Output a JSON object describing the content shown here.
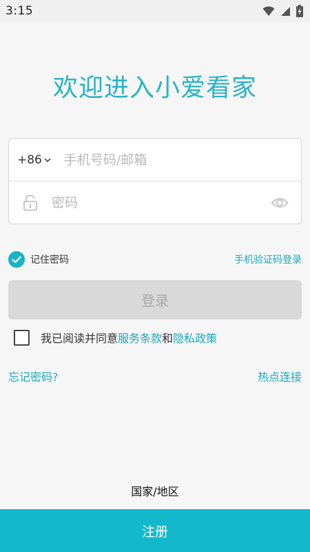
{
  "status_bar": {
    "time": "3:15",
    "icons": [
      "wifi-icon",
      "cellular-signal-icon",
      "battery-charging-icon"
    ]
  },
  "welcome": {
    "title": "欢迎进入小爱看家"
  },
  "login_form": {
    "country_code": "+86",
    "phone_placeholder": "手机号码/邮箱",
    "phone_value": "",
    "password_placeholder": "密码",
    "password_value": "",
    "icons": {
      "lock": "lock-icon",
      "eye": "eye-icon",
      "chevron": "chevron-down-icon"
    }
  },
  "remember": {
    "label": "记住密码",
    "checked": true,
    "sms_login": "手机验证码登录"
  },
  "login_button": {
    "label": "登录"
  },
  "agreement": {
    "checked": false,
    "prefix": "我已阅读并同意",
    "terms": "服务条款",
    "and": "和",
    "privacy": "隐私政策"
  },
  "links": {
    "forgot": "忘记密码?",
    "hotspot": "热点连接"
  },
  "country_region": {
    "label": "国家/地区"
  },
  "register_button": {
    "label": "注册"
  },
  "colors": {
    "accent": "#13b8cb",
    "title": "#2ab3c6",
    "link": "#1aa9bd",
    "disabled_button": "#d9d9d9",
    "background": "#f6f6f6"
  }
}
